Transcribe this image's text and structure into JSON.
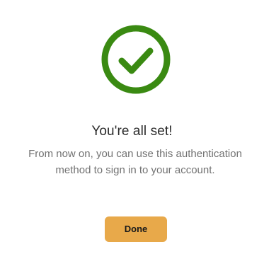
{
  "dialog": {
    "icon": "checkmark-circle-icon",
    "accent_color": "#3a8a12",
    "title": "You're all set!",
    "message": "From now on, you can use this authentication method to sign in to your account.",
    "done_label": "Done",
    "button_color": "#e8a94a"
  }
}
